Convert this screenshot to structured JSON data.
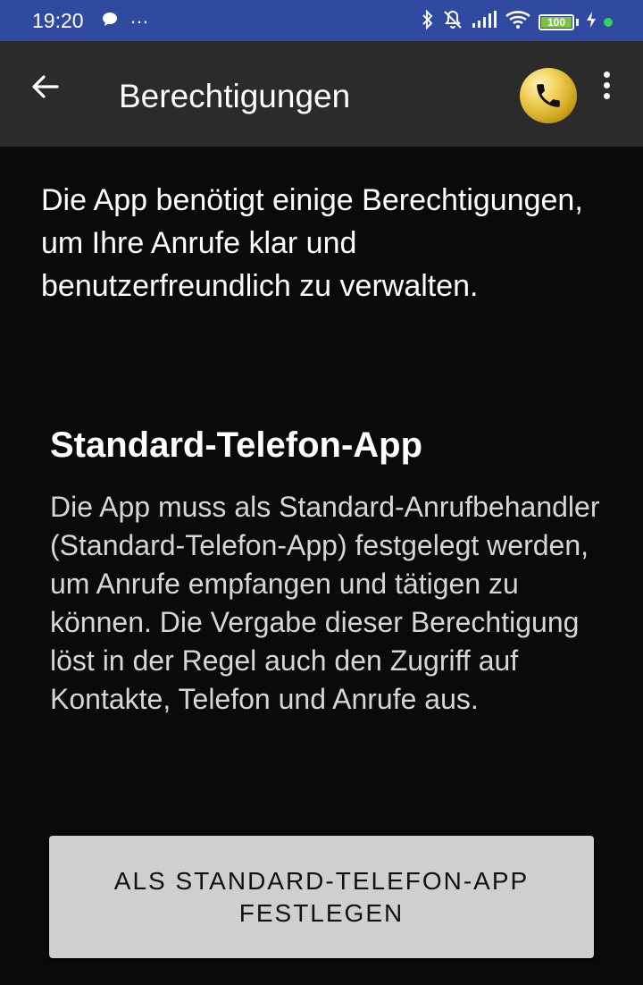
{
  "status_bar": {
    "time": "19:20",
    "dots": "…",
    "battery_level": "100",
    "icons": [
      "chat-bubble-icon",
      "bluetooth-icon",
      "bell-muted-icon",
      "signal-icon",
      "wifi-icon",
      "battery-icon",
      "charging-icon"
    ],
    "accent": "#2f4aa0"
  },
  "app_bar": {
    "title": "Berechtigungen",
    "back_icon": "arrow-left-icon",
    "logo_icon": "phone-icon",
    "menu_icon": "more-vert-icon"
  },
  "content": {
    "intro": "Die App benötigt einige Berechtigungen, um Ihre Anrufe klar und benutzerfreundlich zu verwalten.",
    "section_title": "Standard-Telefon-App",
    "section_description": "Die App muss als Standard-Anrufbehandler (Standard-Telefon-App) festgelegt werden, um Anrufe empfangen und tätigen zu können. Die Vergabe dieser Berechtigung löst in der Regel auch den Zugriff auf Kontakte, Telefon und Anrufe aus.",
    "button_label": "ALS STANDARD-TELEFON-APP FESTLEGEN"
  }
}
